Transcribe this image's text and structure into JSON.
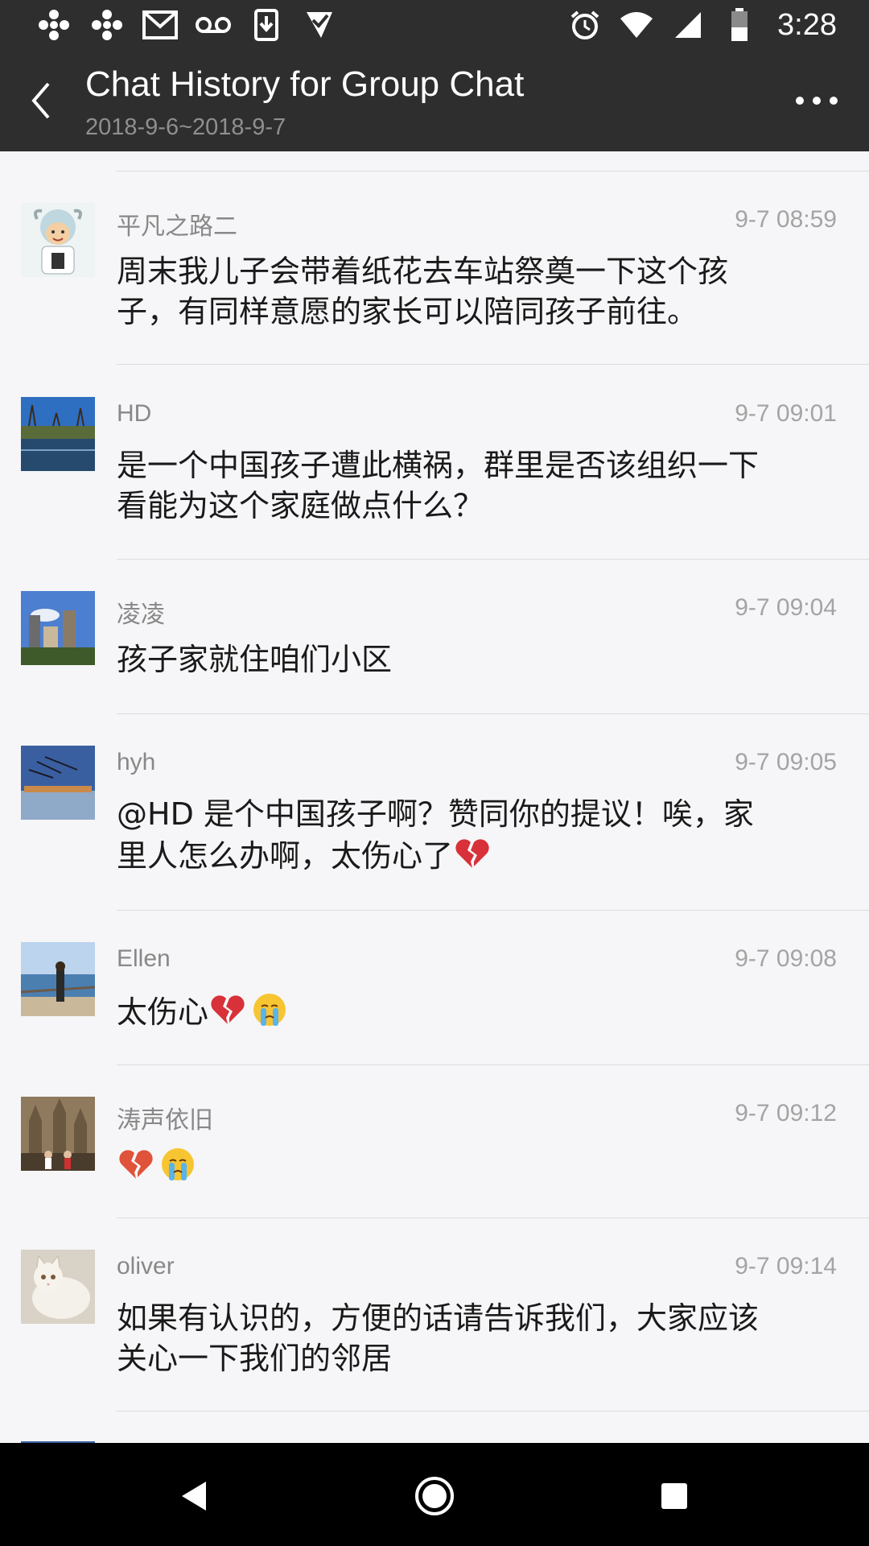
{
  "status_bar": {
    "time": "3:28",
    "left_icons": [
      "cbc-icon",
      "cbc-icon",
      "gmail-icon",
      "voicemail-icon",
      "download-icon",
      "check-app-icon"
    ],
    "right_icons": [
      "alarm-icon",
      "wifi-icon",
      "signal-icon",
      "battery-icon"
    ]
  },
  "header": {
    "title": "Chat History for Group Chat",
    "subtitle": "2018-9-6~2018-9-7"
  },
  "messages": [
    {
      "sender": "平凡之路二",
      "time": "9-7 08:59",
      "lines": [
        "周末我儿子会带着纸花去车站祭奠一下这个孩",
        "子，有同样意愿的家长可以陪同孩子前往。"
      ],
      "avatar": "cartoon-character"
    },
    {
      "sender": "HD",
      "time": "9-7 09:01",
      "lines": [
        "是一个中国孩子遭此横祸，群里是否该组织一下",
        "看能为这个家庭做点什么？"
      ],
      "avatar": "river-landscape"
    },
    {
      "sender": "凌凌",
      "time": "9-7 09:04",
      "lines": [
        "孩子家就住咱们小区"
      ],
      "avatar": "city-buildings"
    },
    {
      "sender": "hyh",
      "time": "9-7 09:05",
      "lines": [
        "@HD 是个中国孩子啊？赞同你的提议！唉，家",
        "里人怎么办啊，太伤心了"
      ],
      "emoji_line2": [
        "broken-heart"
      ],
      "avatar": "skyline-at-dusk"
    },
    {
      "sender": "Ellen",
      "time": "9-7 09:08",
      "lines": [
        "太伤心"
      ],
      "emoji_line1": [
        "broken-heart",
        "crying-face"
      ],
      "avatar": "person-by-sea"
    },
    {
      "sender": "涛声依旧",
      "time": "9-7 09:12",
      "lines": [
        ""
      ],
      "emoji_line1": [
        "broken-heart",
        "crying-face"
      ],
      "avatar": "cathedral-people"
    },
    {
      "sender": "oliver",
      "time": "9-7 09:14",
      "lines": [
        "如果有认识的，方便的话请告诉我们，大家应该",
        "关心一下我们的邻居"
      ],
      "avatar": "white-cat"
    }
  ],
  "colors": {
    "header_bg": "#2e2e2e",
    "background": "#f6f6f8",
    "sender_text": "#888888",
    "time_text": "#a4a4a4"
  },
  "nav_bar": {
    "buttons": [
      "back-triangle-icon",
      "home-circle-icon",
      "recents-square-icon"
    ]
  }
}
